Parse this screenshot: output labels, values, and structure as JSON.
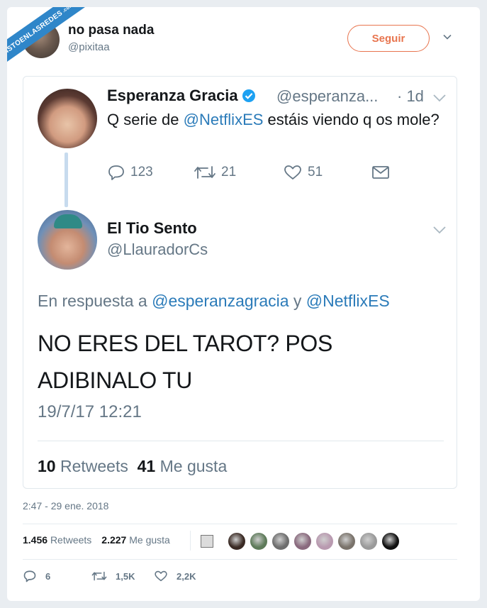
{
  "watermark": {
    "text": "VISTOENLASREDES",
    "suffix": ".com"
  },
  "header": {
    "name": "no pasa nada",
    "handle": "@pixitaa",
    "follow_label": "Seguir"
  },
  "quoted_tweet": {
    "author_name": "Esperanza Gracia",
    "author_handle": "@esperanza...",
    "time": "· 1d",
    "text_before": "Q serie de ",
    "mention": "@NetflixES",
    "text_after": " estáis viendo q os mole?",
    "actions": {
      "replies": "123",
      "retweets": "21",
      "likes": "51"
    }
  },
  "reply_tweet": {
    "author_name": "El Tio Sento",
    "author_handle": "@LlauradorCs",
    "reply_prefix": "En respuesta a ",
    "reply_mention_1": "@esperanzagracia",
    "reply_and": " y ",
    "reply_mention_2": "@NetflixES",
    "text_line_1": "NO ERES DEL TAROT? POS",
    "text_line_2": "ADIBINALO TU",
    "date": "19/7/17 12:21",
    "retweet_count": "10",
    "retweet_label": "Retweets",
    "like_count": "41",
    "like_label": "Me gusta"
  },
  "tweet": {
    "timestamp": "2:47 - 29 ene. 2018",
    "retweet_count": "1.456",
    "retweet_label": "Retweets",
    "like_count": "2.227",
    "like_label": "Me gusta",
    "actions": {
      "replies": "6",
      "retweets": "1,5K",
      "likes": "2,2K"
    }
  },
  "likers": [
    {
      "color": "#3a2a24"
    },
    {
      "color": "#5e7b5a"
    },
    {
      "color": "#6e6e6e"
    },
    {
      "color": "#8a6a7e"
    },
    {
      "color": "#b99ab0"
    },
    {
      "color": "#7a736b"
    },
    {
      "color": "#9a9a9a"
    },
    {
      "color": "#111111"
    }
  ],
  "colors": {
    "link": "#2b7bb9",
    "follow": "#e8754f",
    "muted": "#657786",
    "verified": "#1da1f2"
  }
}
